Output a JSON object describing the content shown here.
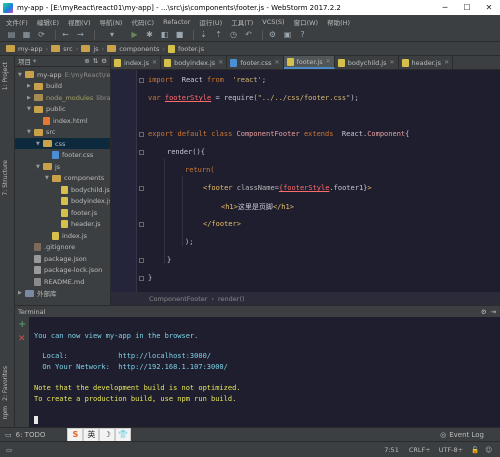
{
  "window": {
    "title": "my-app - [E:\\myReact\\react01\\my-app] - ...\\src\\js\\components\\footer.js - WebStorm 2017.2.2",
    "minimize": "─",
    "maximize": "☐",
    "close": "✕"
  },
  "menu": [
    "文件(F)",
    "编辑(E)",
    "视图(V)",
    "导航(N)",
    "代码(C)",
    "Refactor",
    "运行(U)",
    "工具(T)",
    "VCS(S)",
    "窗口(W)",
    "帮助(H)"
  ],
  "navbar": {
    "crumbs": [
      "my-app",
      "src",
      "js",
      "components",
      "footer.js"
    ]
  },
  "left_stripe": {
    "project": "1: Project",
    "structure": "7: Structure",
    "favorites": "2: Favorites",
    "npm": "npm"
  },
  "project": {
    "header": "项目",
    "tree": [
      {
        "label": "my-app",
        "suffix": "E:\\myReact\\react01\\my-app",
        "type": "folder",
        "depth": 0,
        "open": true
      },
      {
        "label": "build",
        "type": "folder",
        "depth": 1,
        "open": false
      },
      {
        "label": "node_modules",
        "suffix": "library root",
        "type": "folder-excluded",
        "depth": 1,
        "open": false
      },
      {
        "label": "public",
        "type": "folder",
        "depth": 1,
        "open": true
      },
      {
        "label": "index.html",
        "type": "html",
        "depth": 2
      },
      {
        "label": "src",
        "type": "folder",
        "depth": 1,
        "open": true
      },
      {
        "label": "css",
        "type": "folder",
        "depth": 2,
        "open": true,
        "selected": true
      },
      {
        "label": "footer.css",
        "type": "css",
        "depth": 3
      },
      {
        "label": "js",
        "type": "folder",
        "depth": 2,
        "open": true
      },
      {
        "label": "components",
        "type": "folder",
        "depth": 3,
        "open": true
      },
      {
        "label": "bodychild.js",
        "type": "js",
        "depth": 4
      },
      {
        "label": "bodyindex.js",
        "type": "js",
        "depth": 4
      },
      {
        "label": "footer.js",
        "type": "js",
        "depth": 4
      },
      {
        "label": "header.js",
        "type": "js",
        "depth": 4
      },
      {
        "label": "index.js",
        "type": "js",
        "depth": 3
      },
      {
        "label": ".gitignore",
        "type": "git",
        "depth": 1
      },
      {
        "label": "package.json",
        "type": "json",
        "depth": 1
      },
      {
        "label": "package-lock.json",
        "type": "json",
        "depth": 1
      },
      {
        "label": "README.md",
        "type": "md",
        "depth": 1
      },
      {
        "label": "外部库",
        "type": "lib",
        "depth": 0
      }
    ]
  },
  "tabs": [
    {
      "label": "index.js",
      "type": "js"
    },
    {
      "label": "bodyindex.js",
      "type": "js"
    },
    {
      "label": "footer.css",
      "type": "css"
    },
    {
      "label": "footer.js",
      "type": "js",
      "active": true
    },
    {
      "label": "bodychild.js",
      "type": "js"
    },
    {
      "label": "header.js",
      "type": "js"
    }
  ],
  "code": {
    "l1_kw": "import",
    "l1_name": "React",
    "l1_from": "from",
    "l1_str": "'react'",
    "l1_end": ";",
    "l2_kw": "var",
    "l2_var": "footerStyle",
    "l2_eq": " = require(",
    "l2_str": "\"../../css/footer.css\"",
    "l2_end": ");",
    "l3": "export default class",
    "l3_cls": "ComponentFooter",
    "l3_ext": "extends",
    "l3_react": "React.",
    "l3_comp": "Component",
    "l3_brace": "{",
    "l4": "render(){",
    "l5": "return(",
    "l6_open": "<footer",
    "l6_attr": " className=",
    "l6_val": "{footerStyle",
    "l6_val2": ".footer1}",
    "l6_close": ">",
    "l7_open": "<h1>",
    "l7_text": "这里是页脚",
    "l7_close": "</h1>",
    "l8": "</footer>",
    "l9": ");",
    "l10": "}",
    "l11": "}"
  },
  "breadcrumb": [
    "ComponentFooter",
    "›",
    "render()"
  ],
  "terminal": {
    "title": "Terminal",
    "lines": [
      "You can now view my-app in the browser.",
      "",
      "  Local:            http://localhost:3000/",
      "  On Your Network:  http://192.168.1.107:3000/",
      "",
      "Note that the development build is not optimized.",
      "To create a production build, use npm run build."
    ]
  },
  "bottom": {
    "todo": "6: TODO",
    "event_log": "Event Log",
    "ime": [
      "S",
      "英",
      "☽",
      "👕"
    ]
  },
  "status": {
    "position": "7:51",
    "line_sep": "CRLF÷",
    "encoding": "UTF-8÷"
  }
}
